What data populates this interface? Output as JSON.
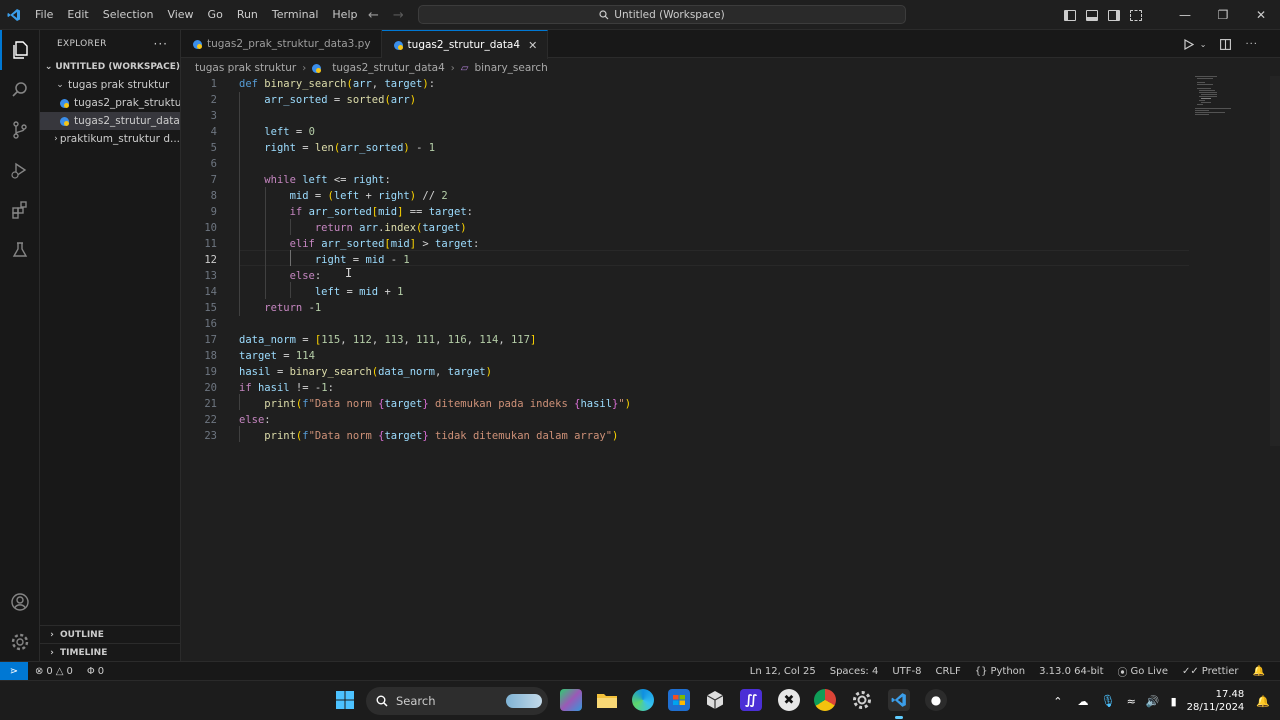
{
  "window": {
    "command_center": "Untitled (Workspace)"
  },
  "menu": [
    "File",
    "Edit",
    "Selection",
    "View",
    "Go",
    "Run",
    "Terminal",
    "Help"
  ],
  "sidebar": {
    "title": "EXPLORER",
    "more": "···",
    "workspace": "UNTITLED (WORKSPACE)",
    "folder": "tugas prak struktur",
    "files": [
      "tugas2_prak_struktu...",
      "tugas2_strutur_data4"
    ],
    "other_folder": "praktikum_struktur d...",
    "outline": "OUTLINE",
    "timeline": "TIMELINE"
  },
  "tabs": [
    {
      "label": "tugas2_prak_struktur_data3.py"
    },
    {
      "label": "tugas2_strutur_data4",
      "close": "✕"
    }
  ],
  "breadcrumbs": {
    "folder": "tugas prak struktur",
    "file": "tugas2_strutur_data4",
    "symbol": "binary_search"
  },
  "editor": {
    "line_numbers": [
      "1",
      "2",
      "3",
      "4",
      "5",
      "6",
      "7",
      "8",
      "9",
      "10",
      "11",
      "12",
      "13",
      "14",
      "15",
      "16",
      "17",
      "18",
      "19",
      "20",
      "21",
      "22",
      "23"
    ],
    "current_line": 12
  },
  "statusbar": {
    "errors": "0",
    "warnings": "0",
    "ports": "0",
    "position": "Ln 12, Col 25",
    "spaces": "Spaces: 4",
    "encoding": "UTF-8",
    "eol": "CRLF",
    "language": "Python",
    "interpreter": "3.13.0 64-bit",
    "golive": "Go Live",
    "prettier": "Prettier"
  },
  "taskbar": {
    "search_label": "Search",
    "time": "17.48",
    "date": "28/11/2024"
  },
  "colors": {
    "accent": "#0078d4",
    "editor_bg": "#1f1f1f",
    "sidebar_bg": "#181818"
  }
}
